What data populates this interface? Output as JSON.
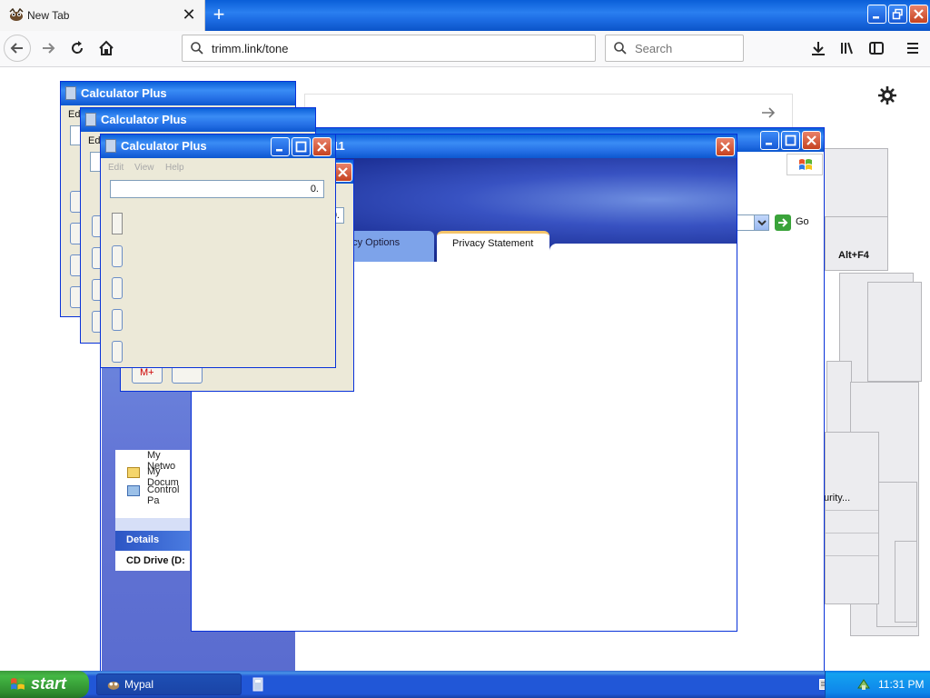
{
  "browser": {
    "tab_title": "New Tab",
    "tab_close": "✕",
    "new_tab": "+",
    "url": "trimm.link/tone",
    "search_placeholder": "Search"
  },
  "windows": {
    "calc_title": "Calculator Plus",
    "calc_display": "0.",
    "calc_menu": [
      "Edit",
      "View",
      "Help"
    ],
    "calc_edit_partial": "Edi",
    "calc_mplus": "M+",
    "dialog_title_partial": "11",
    "tab_privacy_options": "acy Options",
    "tab_privacy_statement": "Privacy Statement",
    "go_label": "Go",
    "alt_f4": "Alt+F4",
    "security_partial": "urity...",
    "details_header": "Details",
    "cd_drive": "CD Drive (D:",
    "places": [
      "My Netwo",
      "My Docum",
      "Control Pa"
    ]
  },
  "taskbar": {
    "start": "start",
    "task_mypal": "Mypal",
    "clock": "11:31 PM"
  },
  "colors": {
    "xp_blue": "#0a5fd8",
    "close_red": "#c6421f",
    "taskbar_blue": "#2157d7",
    "start_green": "#2f8c2f",
    "tray_blue": "#0f86ea"
  }
}
